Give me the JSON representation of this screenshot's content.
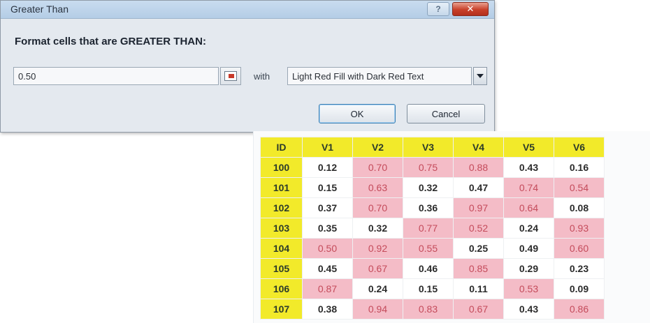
{
  "dialog": {
    "title": "Greater Than",
    "help_label": "?",
    "close_label": "✕",
    "prompt": "Format cells that are GREATER THAN:",
    "value": "0.50",
    "with_label": "with",
    "format_option": "Light Red Fill with Dark Red Text",
    "ok_label": "OK",
    "cancel_label": "Cancel"
  },
  "table": {
    "headers": [
      "ID",
      "V1",
      "V2",
      "V3",
      "V4",
      "V5",
      "V6"
    ],
    "rows": [
      {
        "id": "100",
        "cells": [
          {
            "v": "0.12",
            "hi": false
          },
          {
            "v": "0.70",
            "hi": true
          },
          {
            "v": "0.75",
            "hi": true
          },
          {
            "v": "0.88",
            "hi": true
          },
          {
            "v": "0.43",
            "hi": false
          },
          {
            "v": "0.16",
            "hi": false
          }
        ]
      },
      {
        "id": "101",
        "cells": [
          {
            "v": "0.15",
            "hi": false
          },
          {
            "v": "0.63",
            "hi": true
          },
          {
            "v": "0.32",
            "hi": false
          },
          {
            "v": "0.47",
            "hi": false
          },
          {
            "v": "0.74",
            "hi": true
          },
          {
            "v": "0.54",
            "hi": true
          }
        ]
      },
      {
        "id": "102",
        "cells": [
          {
            "v": "0.37",
            "hi": false
          },
          {
            "v": "0.70",
            "hi": true
          },
          {
            "v": "0.36",
            "hi": false
          },
          {
            "v": "0.97",
            "hi": true
          },
          {
            "v": "0.64",
            "hi": true
          },
          {
            "v": "0.08",
            "hi": false
          }
        ]
      },
      {
        "id": "103",
        "cells": [
          {
            "v": "0.35",
            "hi": false
          },
          {
            "v": "0.32",
            "hi": false
          },
          {
            "v": "0.77",
            "hi": true
          },
          {
            "v": "0.52",
            "hi": true
          },
          {
            "v": "0.24",
            "hi": false
          },
          {
            "v": "0.93",
            "hi": true
          }
        ]
      },
      {
        "id": "104",
        "cells": [
          {
            "v": "0.50",
            "hi": true
          },
          {
            "v": "0.92",
            "hi": true
          },
          {
            "v": "0.55",
            "hi": true
          },
          {
            "v": "0.25",
            "hi": false
          },
          {
            "v": "0.49",
            "hi": false
          },
          {
            "v": "0.60",
            "hi": true
          }
        ]
      },
      {
        "id": "105",
        "cells": [
          {
            "v": "0.45",
            "hi": false
          },
          {
            "v": "0.67",
            "hi": true
          },
          {
            "v": "0.46",
            "hi": false
          },
          {
            "v": "0.85",
            "hi": true
          },
          {
            "v": "0.29",
            "hi": false
          },
          {
            "v": "0.23",
            "hi": false
          }
        ]
      },
      {
        "id": "106",
        "cells": [
          {
            "v": "0.87",
            "hi": true
          },
          {
            "v": "0.24",
            "hi": false
          },
          {
            "v": "0.15",
            "hi": false
          },
          {
            "v": "0.11",
            "hi": false
          },
          {
            "v": "0.53",
            "hi": true
          },
          {
            "v": "0.09",
            "hi": false
          }
        ]
      },
      {
        "id": "107",
        "cells": [
          {
            "v": "0.38",
            "hi": false
          },
          {
            "v": "0.94",
            "hi": true
          },
          {
            "v": "0.83",
            "hi": true
          },
          {
            "v": "0.67",
            "hi": true
          },
          {
            "v": "0.43",
            "hi": false
          },
          {
            "v": "0.86",
            "hi": true
          }
        ]
      }
    ]
  },
  "colors": {
    "header_fill": "#f2ea2a",
    "highlight_fill": "#f4bcc7",
    "highlight_text": "#c44b5b"
  }
}
